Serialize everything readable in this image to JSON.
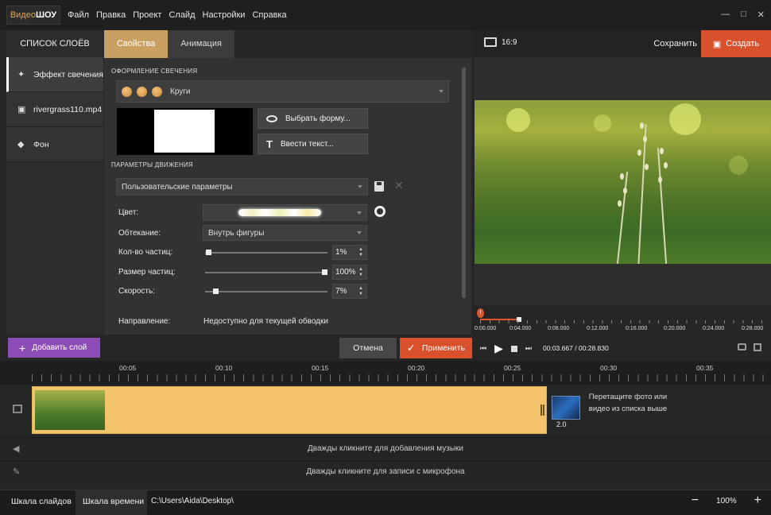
{
  "app": {
    "logo_a": "Видео",
    "logo_b": "ШОУ"
  },
  "menu": [
    "Файл",
    "Правка",
    "Проект",
    "Слайд",
    "Настройки",
    "Справка"
  ],
  "window_controls": [
    "—",
    "□",
    "✕"
  ],
  "layers": {
    "title": "СПИСОК СЛОЁВ",
    "items": [
      {
        "label": "Эффект свечения",
        "icon": "magic-wand-icon"
      },
      {
        "label": "rivergrass110.mp4",
        "icon": "film-icon"
      },
      {
        "label": "Фон",
        "icon": "paint-bucket-icon"
      }
    ],
    "add_label": "Добавить слой"
  },
  "tabs": [
    "Свойства",
    "Анимация"
  ],
  "glow": {
    "section_title": "ОФОРМЛЕНИЕ СВЕЧЕНИЯ",
    "shape_value": "Круги",
    "choose_shape_label": "Выбрать форму...",
    "enter_text_label": "Ввести текст..."
  },
  "motion": {
    "section_title": "ПАРАМЕТРЫ ДВИЖЕНИЯ",
    "preset_value": "Пользовательские параметры",
    "color_label": "Цвет:",
    "wrap_label": "Обтекание:",
    "wrap_value": "Внутрь фигуры",
    "count_label": "Кол-во частиц:",
    "count_value": "1%",
    "count_level": 0.01,
    "size_label": "Размер частиц:",
    "size_value": "100%",
    "size_level": 1.0,
    "speed_label": "Скорость:",
    "speed_value": "7%",
    "speed_level": 0.07,
    "direction_label": "Направление:",
    "direction_value": "Недоступно для текущей обводки"
  },
  "actions": {
    "cancel": "Отмена",
    "apply": "Применить"
  },
  "preview": {
    "aspect": "16:9",
    "save": "Сохранить",
    "create": "Создать",
    "ruler_marks": [
      "0:00.000",
      "0:04.000",
      "0:08.000",
      "0:12.000",
      "0:16.000",
      "0:20.000",
      "0:24.000",
      "0:28.000"
    ],
    "time_current": "00:03.667",
    "time_total": "00:28.830",
    "playhead_marker": "!"
  },
  "timeline": {
    "marks": [
      "00:05",
      "00:10",
      "00:15",
      "00:20",
      "00:25",
      "00:30",
      "00:35"
    ],
    "transition_value": "2.0",
    "drop_hint": "Перетащите фото или видео из списка выше",
    "music_hint": "Дважды кликните для добавления музыки",
    "mic_hint": "Дважды кликните для записи с микрофона"
  },
  "status": {
    "tab_slides": "Шкала слайдов",
    "tab_timeline": "Шкала времени",
    "path": "C:\\Users\\Aida\\Desktop\\",
    "zoom": "100%",
    "zoom_minus": "−",
    "zoom_plus": "+"
  },
  "colors": {
    "accent_orange": "#d9512c",
    "tab_gold": "#c9a062",
    "add_purple": "#8d4db6",
    "clip_yellow": "#f2c36b"
  }
}
